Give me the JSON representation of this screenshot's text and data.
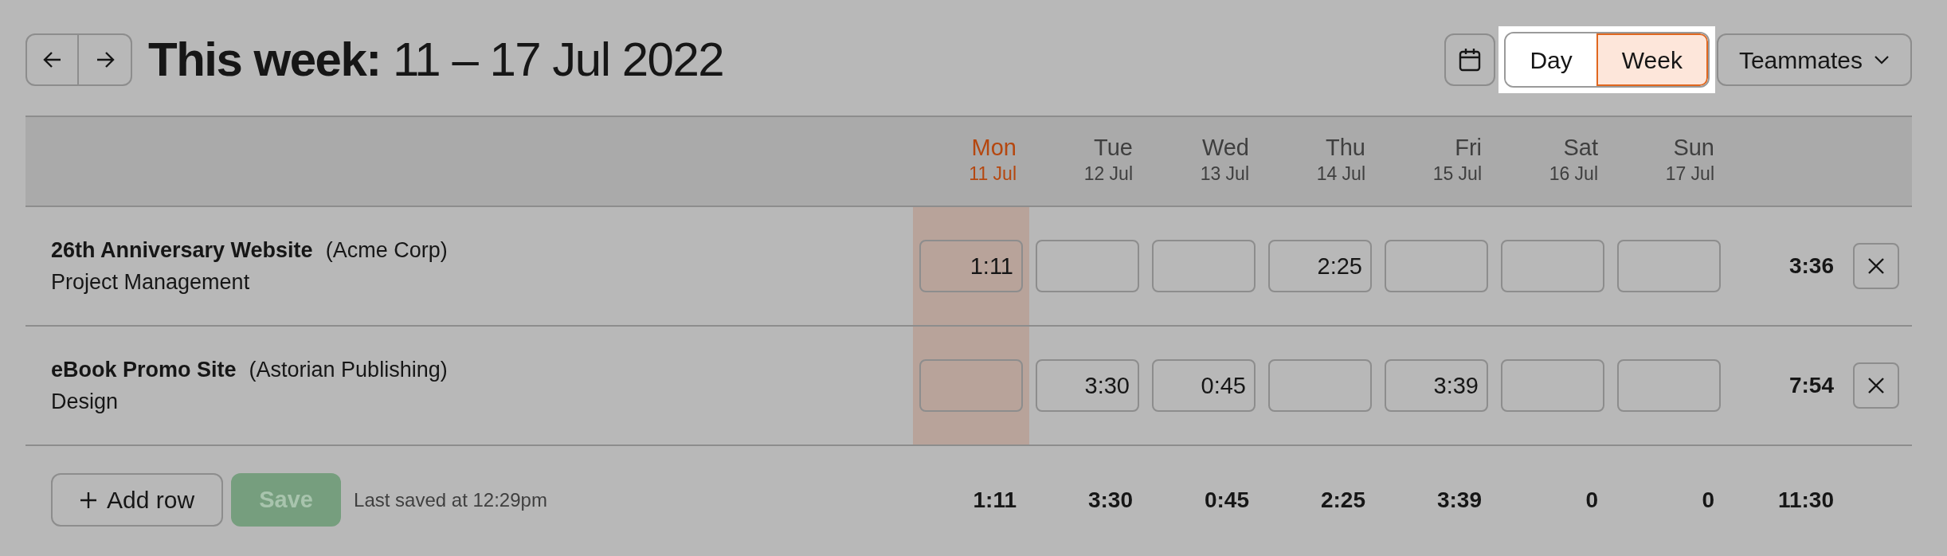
{
  "title": "**This week:** 11 – 17 Jul 2022",
  "view_toggle": [
    {
      "label": "Day",
      "selected": false
    },
    {
      "label": "Week",
      "selected": true
    }
  ],
  "teammates_button": {
    "label": "Teammates"
  },
  "days": [
    {
      "day": "Mon",
      "date": "11 Jul",
      "today": true
    },
    {
      "day": "Tue",
      "date": "12 Jul",
      "today": false
    },
    {
      "day": "Wed",
      "date": "13 Jul",
      "today": false
    },
    {
      "day": "Thu",
      "date": "14 Jul",
      "today": false
    },
    {
      "day": "Fri",
      "date": "15 Jul",
      "today": false
    },
    {
      "day": "Sat",
      "date": "16 Jul",
      "today": false
    },
    {
      "day": "Sun",
      "date": "17 Jul",
      "today": false
    }
  ],
  "rows": [
    {
      "project": "26th Anniversary Website",
      "client": "(Acme Corp)",
      "task": "Project Management",
      "entries": {
        "mon": "1:11",
        "thu": "2:25"
      },
      "total": "3:36"
    },
    {
      "project": "eBook Promo Site",
      "client": "(Astorian Publishing)",
      "task": "Design",
      "entries": {
        "tue": "3:30",
        "wed": "0:45",
        "fri": "3:39"
      },
      "total": "7:54"
    }
  ],
  "footer": {
    "add_row": "Add row",
    "save": {
      "label": "Save",
      "disabled": true
    },
    "last_saved": "Last saved at 12:29pm",
    "totals": [
      "1:11",
      "3:30",
      "0:45",
      "2:25",
      "3:39",
      "0",
      "0"
    ],
    "grand_total": "11:30"
  }
}
